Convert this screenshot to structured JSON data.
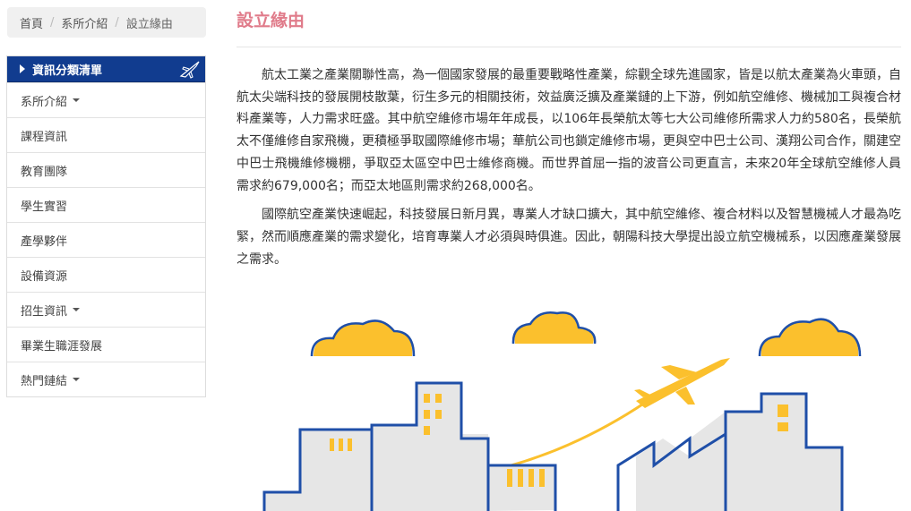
{
  "breadcrumb": {
    "home": "首頁",
    "section": "系所介紹",
    "current": "設立緣由"
  },
  "sidebar": {
    "title": "資訊分類清單",
    "items": [
      {
        "label": "系所介紹",
        "has_dropdown": true
      },
      {
        "label": "課程資訊",
        "has_dropdown": false
      },
      {
        "label": "教育團隊",
        "has_dropdown": false
      },
      {
        "label": "學生實習",
        "has_dropdown": false
      },
      {
        "label": "產學夥伴",
        "has_dropdown": false
      },
      {
        "label": "設備資源",
        "has_dropdown": false
      },
      {
        "label": "招生資訊",
        "has_dropdown": true
      },
      {
        "label": "畢業生職涯發展",
        "has_dropdown": false
      },
      {
        "label": "熱門鏈結",
        "has_dropdown": true
      }
    ]
  },
  "main": {
    "title": "設立緣由",
    "paragraphs": [
      "航太工業之產業關聯性高，為一個國家發展的最重要戰略性產業，綜觀全球先進國家，皆是以航太產業為火車頭，自航太尖端科技的發展開枝散葉，衍生多元的相關技術，效益廣泛擴及產業鏈的上下游，例如航空維修、機械加工與複合材料產業等，人力需求旺盛。其中航空維修市場年年成長，以106年長榮航太等七大公司維修所需求人力約580名，長榮航太不僅維修自家飛機，更積極爭取國際維修市場；華航公司也鎖定維修市場，更與空中巴士公司、漢翔公司合作，關建空中巴士飛機維修機棚，爭取亞太區空中巴士維修商機。而世界首屈一指的波音公司更直言，未來20年全球航空維修人員需求約679,000名；而亞太地區則需求約268,000名。",
      "國際航空產業快速崛起，科技發展日新月異，專業人才缺口擴大，其中航空維修、複合材料以及智慧機械人才最為吃緊，然而順應產業的需求變化，培育專業人才必須與時俱進。因此，朝陽科技大學提出設立航空機械系，以因應產業發展之需求。"
    ]
  },
  "colors": {
    "title_pink": "#e07b8a",
    "sidebar_header_blue": "#113c8f",
    "cloud_yellow": "#fbc02d",
    "building_blue": "#1f4fa8",
    "building_gray": "#e6e6e6"
  },
  "icons": {
    "sidebar_header": "airplane-icon",
    "dropdown": "caret-down-icon",
    "illustration": "city-airplane-illustration"
  }
}
